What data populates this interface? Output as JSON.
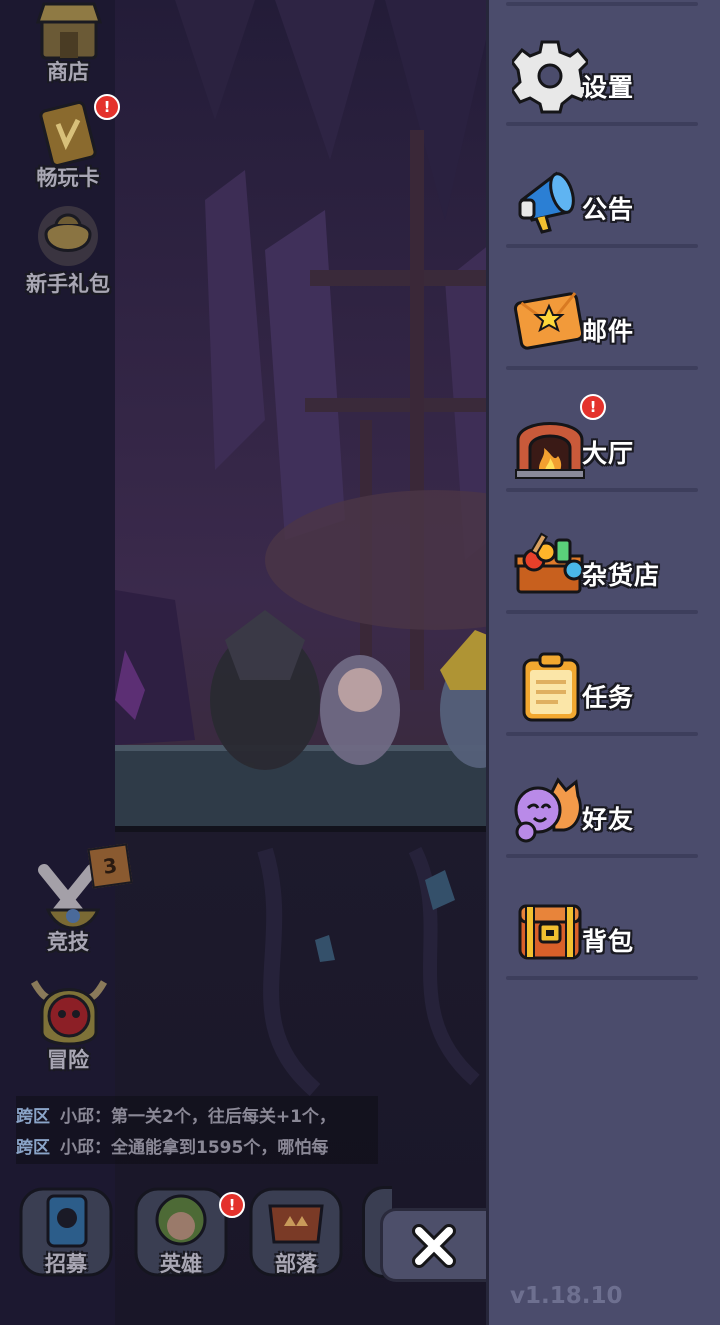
{
  "left_icons": [
    {
      "label": "商店",
      "icon": "shop-icon"
    },
    {
      "label": "畅玩卡",
      "icon": "play-card-icon",
      "badge": "!"
    },
    {
      "label": "新手礼包",
      "icon": "gift-bag-icon"
    }
  ],
  "modes": [
    {
      "label": "竞技",
      "icon": "arena-icon",
      "count": "3"
    },
    {
      "label": "冒险",
      "icon": "skull-adventure-icon"
    }
  ],
  "chat": [
    {
      "tag": "跨区",
      "name": "小邱：",
      "text": "第一关2个，往后每关+1个，"
    },
    {
      "tag": "跨区",
      "name": "小邱：",
      "text": "全通能拿到1595个，哪怕每"
    }
  ],
  "bottom_nav": [
    {
      "label": "招募",
      "icon": "recruit-card-icon"
    },
    {
      "label": "英雄",
      "icon": "hero-icon",
      "badge": "!"
    },
    {
      "label": "部落",
      "icon": "tribe-icon"
    }
  ],
  "side_menu": [
    {
      "label": "设置",
      "icon": "gear-icon"
    },
    {
      "label": "公告",
      "icon": "megaphone-icon"
    },
    {
      "label": "邮件",
      "icon": "mail-icon"
    },
    {
      "label": "大厅",
      "icon": "fireplace-hall-icon",
      "badge": "!"
    },
    {
      "label": "杂货店",
      "icon": "grocery-chest-icon"
    },
    {
      "label": "任务",
      "icon": "task-clipboard-icon"
    },
    {
      "label": "好友",
      "icon": "friends-icon"
    },
    {
      "label": "背包",
      "icon": "backpack-chest-icon"
    }
  ],
  "version": "v1.18.10",
  "close_icon": "close-x-icon",
  "colors": {
    "panel": "#4b4c6c",
    "separator": "#3d3e5c",
    "badge": "#e4322c",
    "scene": "#1c1830"
  }
}
